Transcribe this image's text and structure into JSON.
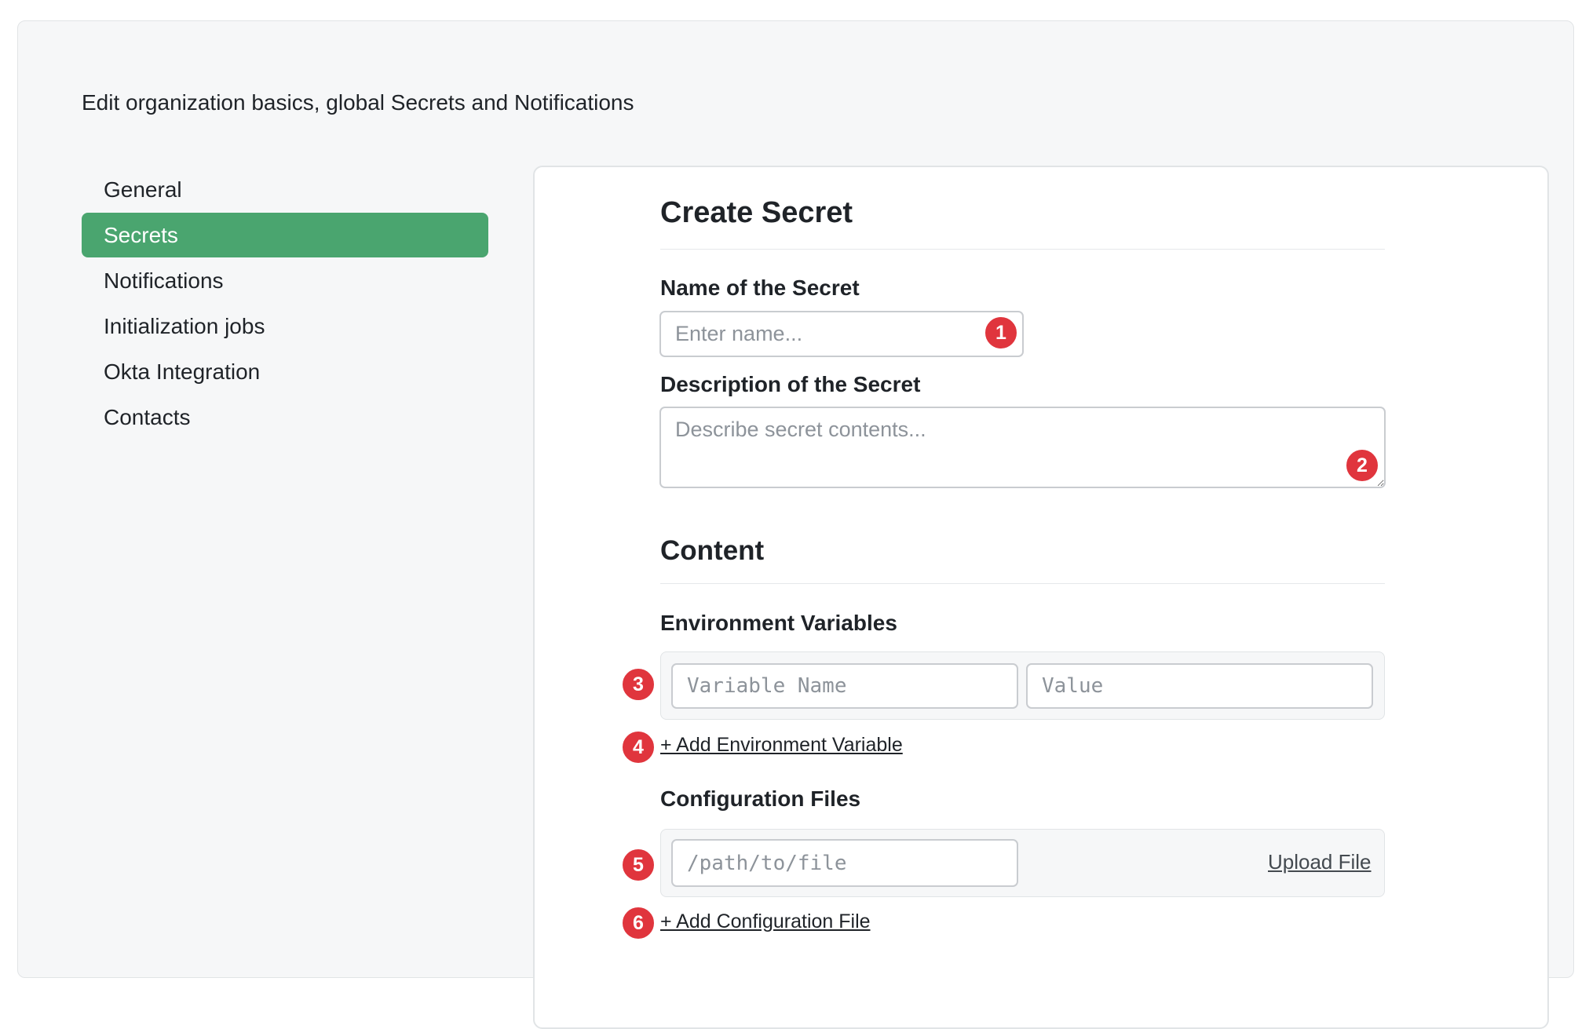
{
  "page": {
    "subtitle": "Edit organization basics, global Secrets and Notifications"
  },
  "sidebar": {
    "items": [
      {
        "label": "General",
        "active": false
      },
      {
        "label": "Secrets",
        "active": true
      },
      {
        "label": "Notifications",
        "active": false
      },
      {
        "label": "Initialization jobs",
        "active": false
      },
      {
        "label": "Okta Integration",
        "active": false
      },
      {
        "label": "Contacts",
        "active": false
      }
    ]
  },
  "form": {
    "title": "Create Secret",
    "name_label": "Name of the Secret",
    "name_placeholder": "Enter name...",
    "description_label": "Description of the Secret",
    "description_placeholder": "Describe secret contents...",
    "content_heading": "Content",
    "env_vars_label": "Environment Variables",
    "var_name_placeholder": "Variable Name",
    "var_value_placeholder": "Value",
    "add_env_var_label": "+ Add Environment Variable",
    "config_files_label": "Configuration Files",
    "file_path_placeholder": "/path/to/file",
    "upload_file_label": "Upload File",
    "add_config_file_label": "+ Add Configuration File"
  },
  "annotations": [
    "1",
    "2",
    "3",
    "4",
    "5",
    "6"
  ],
  "colors": {
    "accent": "#4aa56f",
    "badge": "#e0353d",
    "background": "#f6f7f8"
  }
}
